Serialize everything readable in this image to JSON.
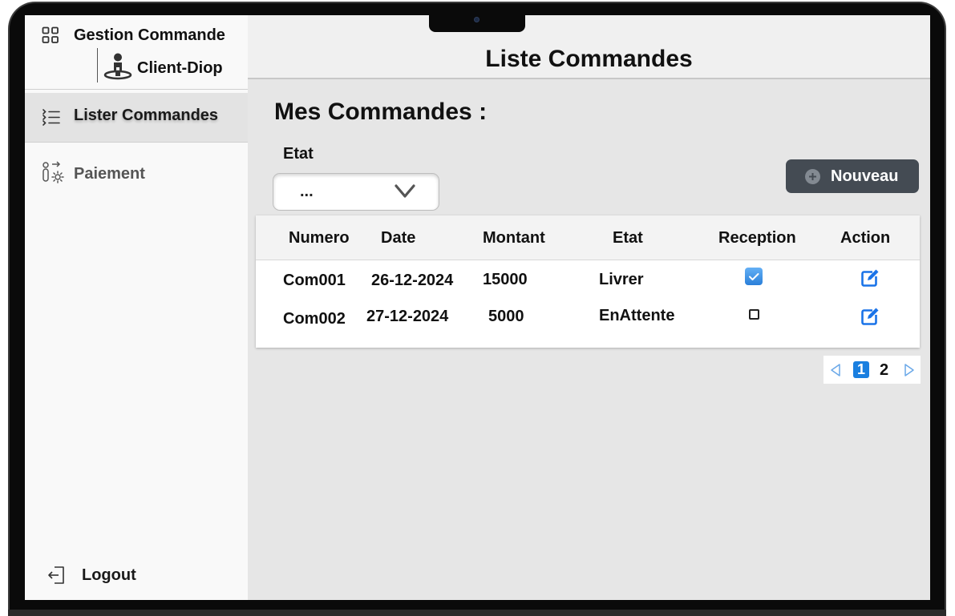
{
  "app": {
    "title": "Gestion Commande",
    "user": "Client-Diop"
  },
  "sidebar": {
    "items": [
      {
        "label": "Lister Commandes",
        "icon": "list-icon",
        "active": true
      },
      {
        "label": "Paiement",
        "icon": "payment-settings-icon",
        "active": false
      }
    ],
    "logout": "Logout"
  },
  "header": {
    "title": "Liste Commandes"
  },
  "main": {
    "section_title": "Mes Commandes :",
    "filter": {
      "label": "Etat",
      "value": "..."
    },
    "new_button": "Nouveau",
    "table": {
      "columns": [
        "Numero",
        "Date",
        "Montant",
        "Etat",
        "Reception",
        "Action"
      ],
      "rows": [
        {
          "numero": "Com001",
          "date": "26-12-2024",
          "montant": "15000",
          "etat": "Livrer",
          "reception": true
        },
        {
          "numero": "Com002",
          "date": "27-12-2024",
          "montant": "5000",
          "etat": "EnAttente",
          "reception": false
        }
      ]
    },
    "pagination": {
      "current": "1",
      "pages": [
        "1",
        "2"
      ]
    }
  },
  "colors": {
    "accent": "#1a7fe0",
    "button": "#444b53",
    "sidebar_bg": "#f9f9f9",
    "content_bg": "#e6e6e6"
  }
}
